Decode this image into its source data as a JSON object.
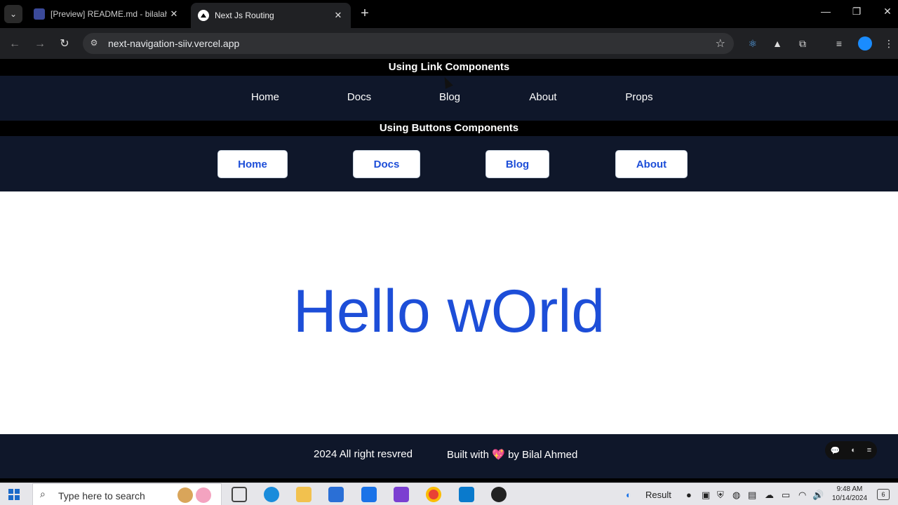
{
  "browser": {
    "tabs": [
      {
        "title": "[Preview] README.md - bilalah"
      },
      {
        "title": "Next Js Routing"
      }
    ],
    "url": "next-navigation-siiv.vercel.app"
  },
  "page": {
    "link_section_title": "Using Link Components",
    "links": [
      "Home",
      "Docs",
      "Blog",
      "About",
      "Props"
    ],
    "button_section_title": "Using Buttons Components",
    "buttons": [
      "Home",
      "Docs",
      "Blog",
      "About"
    ],
    "hero": "Hello wOrld",
    "footer": {
      "copyright": "2024 All right resvred",
      "built_prefix": "Built with",
      "built_heart": "💖",
      "built_suffix": "by Bilal Ahmed"
    }
  },
  "taskbar": {
    "search_placeholder": "Type here to search",
    "result_label": "Result",
    "time": "9:48 AM",
    "date": "10/14/2024",
    "notification_count": "6"
  },
  "colors": {
    "nav_bg": "#0f172a",
    "accent": "#1d4ed8"
  }
}
